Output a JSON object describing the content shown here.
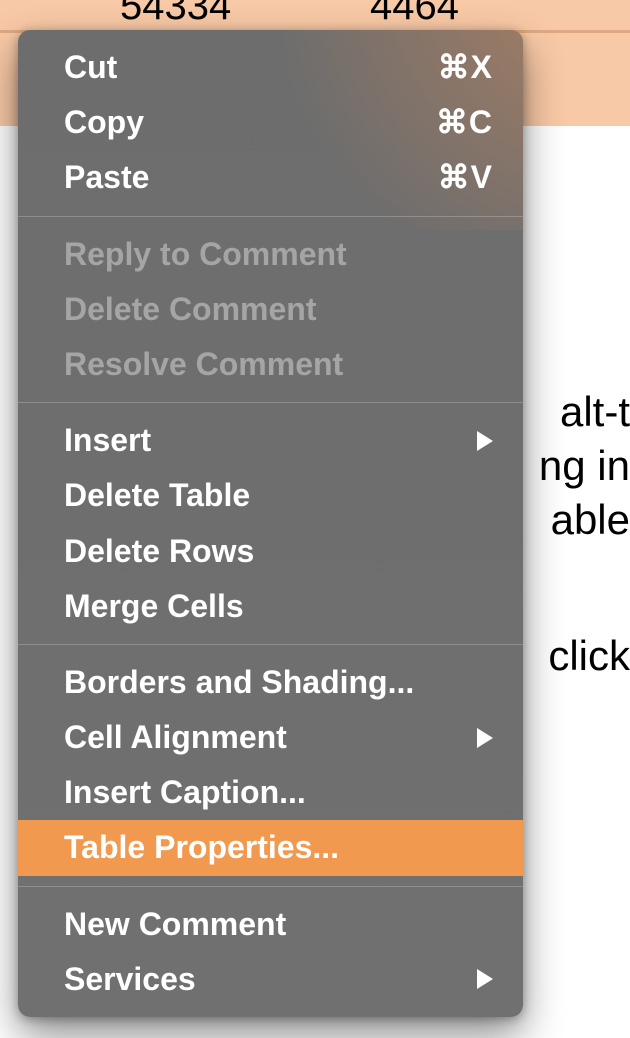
{
  "background": {
    "cell1": "54334",
    "cell2": "4464",
    "text1": "alt-t",
    "text2": "ng in",
    "text3": "able",
    "text4": "click"
  },
  "menu": {
    "group1": [
      {
        "label": "Cut",
        "shortcut": "⌘X"
      },
      {
        "label": "Copy",
        "shortcut": "⌘C"
      },
      {
        "label": "Paste",
        "shortcut": "⌘V"
      }
    ],
    "group2": [
      {
        "label": "Reply to Comment"
      },
      {
        "label": "Delete Comment"
      },
      {
        "label": "Resolve Comment"
      }
    ],
    "group3": [
      {
        "label": "Insert",
        "submenu": true
      },
      {
        "label": "Delete Table"
      },
      {
        "label": "Delete Rows"
      },
      {
        "label": "Merge Cells"
      }
    ],
    "group4": [
      {
        "label": "Borders and Shading..."
      },
      {
        "label": "Cell Alignment",
        "submenu": true
      },
      {
        "label": "Insert Caption..."
      },
      {
        "label": "Table Properties...",
        "highlight": true
      }
    ],
    "group5": [
      {
        "label": "New Comment"
      },
      {
        "label": "Services",
        "submenu": true
      }
    ]
  }
}
